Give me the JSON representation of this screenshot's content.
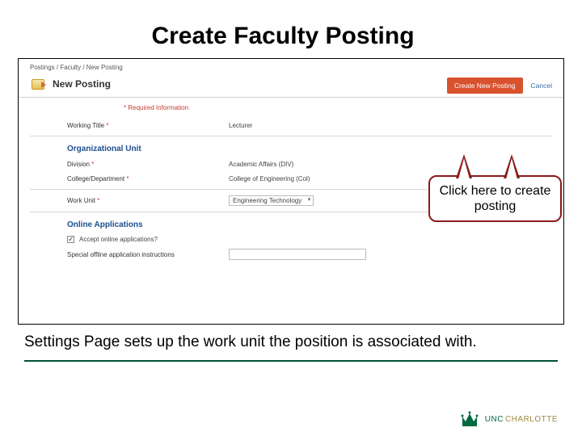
{
  "slide": {
    "title": "Create Faculty Posting",
    "caption": "Settings Page sets up the work unit the position is associated with."
  },
  "breadcrumb": "Postings / Faculty / New Posting",
  "header": {
    "title": "New Posting",
    "create_btn": "Create New Posting",
    "cancel": "Cancel"
  },
  "required_label": "* Required Information",
  "fields": {
    "working_title": {
      "label": "Working Title",
      "value": "Lecturer"
    },
    "division": {
      "label": "Division",
      "value": "Academic Affairs (DIV)"
    },
    "college": {
      "label": "College/Department",
      "value": "College of Engineering (Col)"
    },
    "work_unit": {
      "label": "Work Unit",
      "value": "Engineering Technology"
    }
  },
  "sections": {
    "org_unit": "Organizational Unit",
    "online_apps": "Online Applications"
  },
  "online": {
    "accept_label": "Accept online applications?",
    "checked": true,
    "special_label": "Special offline application instructions"
  },
  "callout": {
    "text": "Click here to create posting"
  },
  "logo": {
    "line1": "UNC",
    "line2": "CHARLOTTE"
  }
}
